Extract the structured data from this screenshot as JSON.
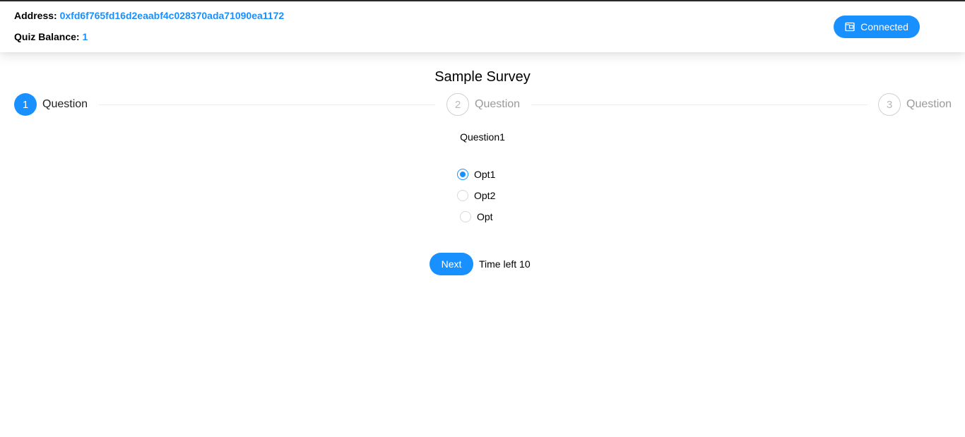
{
  "header": {
    "address_label": "Address:",
    "address_value": "0xfd6f765fd16d2eaabf4c028370ada71090ea1172",
    "balance_label": "Quiz Balance:",
    "balance_value": "1",
    "connect_button": {
      "label": "Connected",
      "icon": "wallet-icon"
    }
  },
  "survey": {
    "title": "Sample Survey",
    "steps": [
      {
        "number": "1",
        "label": "Question",
        "status": "active"
      },
      {
        "number": "2",
        "label": "Question",
        "status": "wait"
      },
      {
        "number": "3",
        "label": "Question",
        "status": "wait"
      }
    ],
    "question": "Question1",
    "options": [
      {
        "label": "Opt1",
        "selected": true
      },
      {
        "label": "Opt2",
        "selected": false
      },
      {
        "label": "Opt",
        "selected": false
      }
    ],
    "next_label": "Next",
    "time_left": "Time left 10"
  },
  "colors": {
    "accent": "#1890ff",
    "header_bg": "#ffffff",
    "step_wait_border": "#d0d0d0",
    "step_wait_text": "#9a9a9a"
  }
}
